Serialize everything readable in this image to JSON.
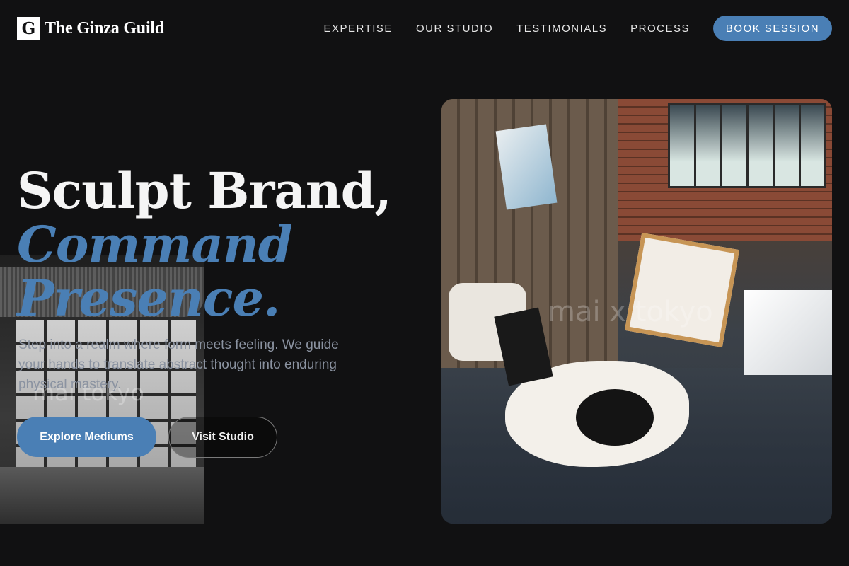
{
  "nav": {
    "logo_mark": "G",
    "brand_name": "The Ginza Guild",
    "links": [
      "EXPERTISE",
      "OUR STUDIO",
      "TESTIMONIALS",
      "PROCESS"
    ],
    "cta_label": "BOOK SESSION"
  },
  "hero": {
    "title_line1": "Sculpt Brand,",
    "title_accent_line1": "Command",
    "title_accent_line2": "Presence.",
    "body": "Step into a realm where form meets feeling. We guide your hands to translate abstract thought into enduring physical mastery.",
    "primary_button": "Explore Mediums",
    "secondary_button": "Visit Studio"
  },
  "images": {
    "background_watermark": "mai tokyo",
    "studio_watermark": "mai x tokyo"
  },
  "colors": {
    "accent": "#4a7fb5",
    "background": "#111112",
    "body_text": "#8b93a1"
  }
}
